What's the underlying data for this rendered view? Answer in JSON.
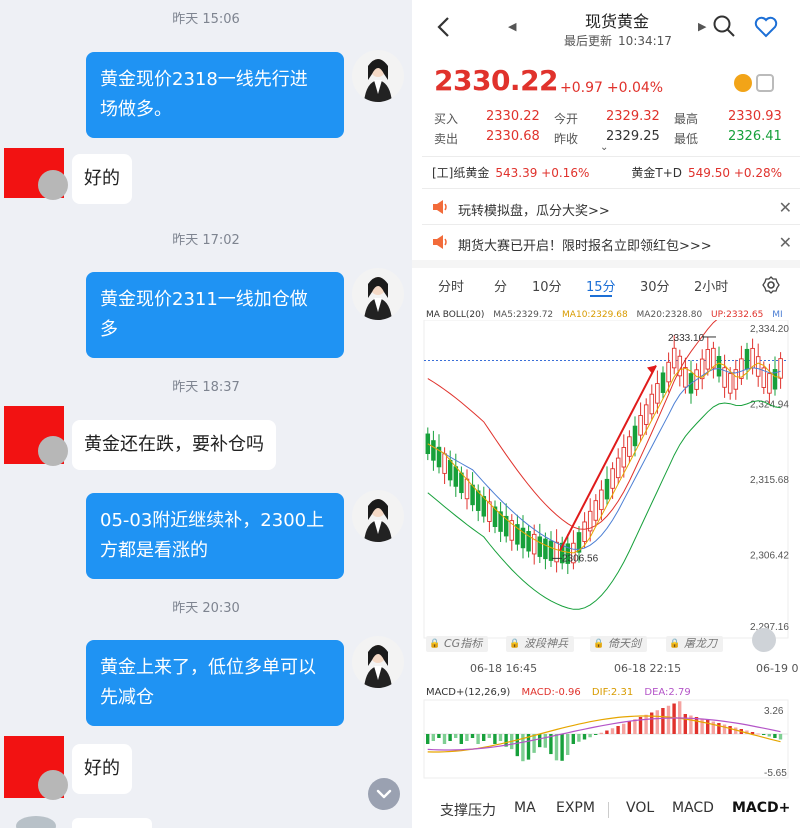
{
  "chat": {
    "timestamps": [
      "昨天 15:06",
      "昨天 17:02",
      "昨天 18:37",
      "昨天 20:30"
    ],
    "messages": [
      {
        "side": "right",
        "lines": [
          "黄金现价2318一线先行进",
          "场做多。"
        ]
      },
      {
        "side": "left",
        "lines": [
          "好的"
        ]
      },
      {
        "side": "right",
        "lines": [
          "黄金现价2311一线加仓做",
          "多"
        ]
      },
      {
        "side": "left",
        "lines": [
          "黄金还在跌，要补仓吗"
        ]
      },
      {
        "side": "right",
        "lines": [
          "05-03附近继续补，2300上",
          "方都是看涨的"
        ]
      },
      {
        "side": "right",
        "lines": [
          "黄金上来了，低位多单可以",
          "先减仓"
        ]
      },
      {
        "side": "left",
        "lines": [
          "好的"
        ]
      }
    ],
    "scroll_down_icon": "chevron-down-icon"
  },
  "quote": {
    "title": "现货黄金",
    "updated_label": "最后更新",
    "updated_time": "10:34:17",
    "price": "2330.22",
    "change": "+0.97",
    "change_pct": "+0.04%",
    "stats": {
      "buy_label": "买入",
      "buy": "2330.22",
      "sell_label": "卖出",
      "sell": "2330.68",
      "open_label": "今开",
      "open": "2329.32",
      "prev_label": "昨收",
      "prev": "2329.25",
      "high_label": "最高",
      "high": "2330.93",
      "low_label": "最低",
      "low": "2326.41"
    },
    "related": {
      "left_name": "[工]纸黄金",
      "left_val": "543.39 +0.16%",
      "right_name": "黄金T+D",
      "right_val": "549.50 +0.28%"
    },
    "notices": [
      "玩转模拟盘，瓜分大奖>>",
      "期货大赛已开启！限时报名立即领红包>>>"
    ],
    "tabs": [
      "分时",
      "分",
      "10分",
      "15分",
      "30分",
      "2小时"
    ],
    "active_tab": "15分",
    "indicator_legend": {
      "name": "MA BOLL(20)",
      "ma5": "MA5:2329.72",
      "ma10": "MA10:2329.68",
      "ma20": "MA20:2328.80",
      "up": "UP:2332.65",
      "mid": "MI"
    },
    "y_axis_labels": [
      "2,334.20",
      "2,324.94",
      "2,315.68",
      "2,306.42",
      "2,297.16"
    ],
    "annotations": {
      "high": "2333.10",
      "low": "2306.56"
    },
    "locked_tools": [
      "CG指标",
      "波段神兵",
      "倚天剑",
      "屠龙刀"
    ],
    "x_axis_labels": [
      "06-18 16:45",
      "06-18 22:15",
      "06-19 0"
    ],
    "macd_legend": {
      "name": "MACD+(12,26,9)",
      "macd": "MACD:-0.96",
      "dif": "DIF:2.31",
      "dea": "DEA:2.79"
    },
    "macd_axis": [
      "3.26",
      "-5.65"
    ],
    "bottom_tabs": [
      "支撑压力",
      "MA",
      "EXPM",
      "VOL",
      "MACD",
      "MACD+"
    ],
    "active_bottom_tab": "MACD+",
    "colors": {
      "up": "#e0322c",
      "down": "#17a03b",
      "accent": "#1c6fd6",
      "bubble": "#1f93f3"
    }
  }
}
